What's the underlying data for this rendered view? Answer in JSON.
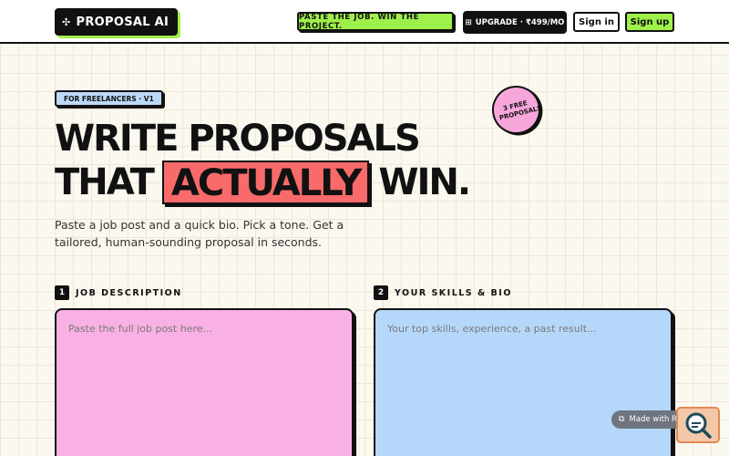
{
  "header": {
    "logo_icon": "✣",
    "logo_text": "PROPOSAL AI",
    "tagline": "PASTE THE JOB. WIN THE PROJECT.",
    "upgrade_icon": "⊞",
    "upgrade_label": "UPGRADE · ₹499/MO",
    "signin_label": "Sign in",
    "signup_label": "Sign up"
  },
  "hero": {
    "badge": "FOR FREELANCERS · V1",
    "sticker": "3 FREE PROPOSALS",
    "headline_line1": "WRITE PROPOSALS",
    "headline_line2_start": "THAT",
    "headline_highlight": "ACTUALLY",
    "headline_line2_end": "WIN.",
    "subtitle": "Paste a job post and a quick bio. Pick a tone. Get a tailored, human-sounding proposal in seconds."
  },
  "form": {
    "job": {
      "step": "1",
      "label": "JOB DESCRIPTION",
      "placeholder": "Paste the full job post here..."
    },
    "bio": {
      "step": "2",
      "label": "YOUR SKILLS & BIO",
      "placeholder": "Your top skills, experience, a past result..."
    }
  },
  "footer": {
    "replit_badge": "Made with Replit"
  },
  "colors": {
    "accent_green": "#9ef04a",
    "highlight_red": "#f96a6a",
    "job_pink": "#f9b1e5",
    "bio_blue": "#b5d8fa"
  }
}
